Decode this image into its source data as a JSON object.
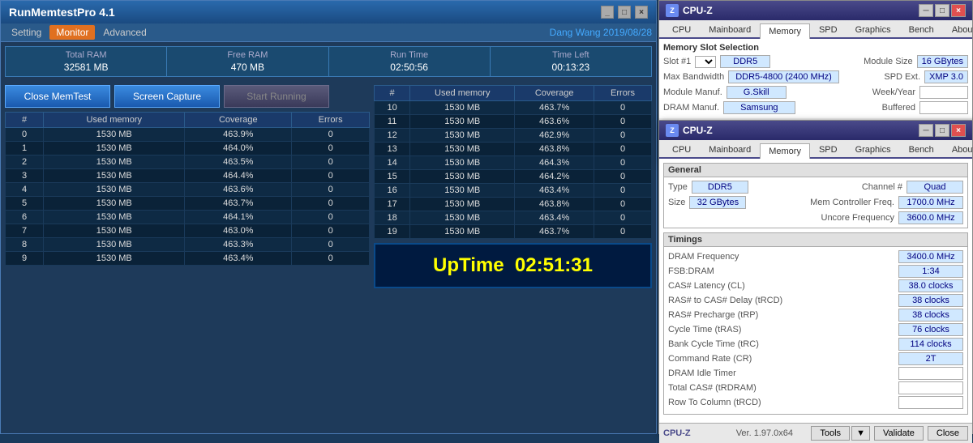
{
  "memtest": {
    "title": "RunMemtestPro 4.1",
    "menu": {
      "items": [
        "Setting",
        "Monitor",
        "Advanced"
      ],
      "active": "Monitor"
    },
    "user_info": "Dang Wang 2019/08/28",
    "stats": {
      "total_ram_label": "Total RAM",
      "free_ram_label": "Free RAM",
      "run_time_label": "Run Time",
      "time_left_label": "Time Left",
      "total_ram": "32581 MB",
      "free_ram": "470 MB",
      "run_time": "02:50:56",
      "time_left": "00:13:23"
    },
    "buttons": {
      "close": "Close MemTest",
      "capture": "Screen Capture",
      "start": "Start Running"
    },
    "left_table": {
      "headers": [
        "#",
        "Used memory",
        "Coverage",
        "Errors"
      ],
      "rows": [
        [
          "0",
          "1530 MB",
          "463.9%",
          "0"
        ],
        [
          "1",
          "1530 MB",
          "464.0%",
          "0"
        ],
        [
          "2",
          "1530 MB",
          "463.5%",
          "0"
        ],
        [
          "3",
          "1530 MB",
          "464.4%",
          "0"
        ],
        [
          "4",
          "1530 MB",
          "463.6%",
          "0"
        ],
        [
          "5",
          "1530 MB",
          "463.7%",
          "0"
        ],
        [
          "6",
          "1530 MB",
          "464.1%",
          "0"
        ],
        [
          "7",
          "1530 MB",
          "463.0%",
          "0"
        ],
        [
          "8",
          "1530 MB",
          "463.3%",
          "0"
        ],
        [
          "9",
          "1530 MB",
          "463.4%",
          "0"
        ]
      ]
    },
    "right_table": {
      "headers": [
        "#",
        "Used memory",
        "Coverage",
        "Errors"
      ],
      "rows": [
        [
          "10",
          "1530 MB",
          "463.7%",
          "0"
        ],
        [
          "11",
          "1530 MB",
          "463.6%",
          "0"
        ],
        [
          "12",
          "1530 MB",
          "462.9%",
          "0"
        ],
        [
          "13",
          "1530 MB",
          "463.8%",
          "0"
        ],
        [
          "14",
          "1530 MB",
          "464.3%",
          "0"
        ],
        [
          "15",
          "1530 MB",
          "464.2%",
          "0"
        ],
        [
          "16",
          "1530 MB",
          "463.4%",
          "0"
        ],
        [
          "17",
          "1530 MB",
          "463.8%",
          "0"
        ],
        [
          "18",
          "1530 MB",
          "463.4%",
          "0"
        ],
        [
          "19",
          "1530 MB",
          "463.7%",
          "0"
        ]
      ]
    },
    "uptime_label": "UpTime",
    "uptime_value": "02:51:31"
  },
  "cpuz_window1": {
    "title": "CPU-Z",
    "tabs": [
      "CPU",
      "Mainboard",
      "Memory",
      "SPD",
      "Graphics",
      "Bench",
      "About"
    ],
    "active_tab": "Memory",
    "slot_section": {
      "title": "Memory Slot Selection",
      "slot_label": "Slot #1",
      "ddr_type": "DDR5",
      "module_size_label": "Module Size",
      "module_size": "16 GBytes",
      "max_bw_label": "Max Bandwidth",
      "max_bw": "DDR5-4800 (2400 MHz)",
      "spd_ext_label": "SPD Ext.",
      "spd_ext": "XMP 3.0",
      "module_manuf_label": "Module Manuf.",
      "module_manuf": "G.Skill",
      "week_year_label": "Week/Year",
      "week_year": "",
      "dram_manuf_label": "DRAM Manuf.",
      "dram_manuf": "Samsung",
      "buffered_label": "Buffered",
      "buffered": ""
    }
  },
  "cpuz_window2": {
    "title": "CPU-Z",
    "tabs": [
      "CPU",
      "Mainboard",
      "Memory",
      "SPD",
      "Graphics",
      "Bench",
      "About"
    ],
    "active_tab": "Memory",
    "general": {
      "title": "General",
      "type_label": "Type",
      "type": "DDR5",
      "channel_label": "Channel #",
      "channel": "Quad",
      "size_label": "Size",
      "size": "32 GBytes",
      "mem_ctrl_freq_label": "Mem Controller Freq.",
      "mem_ctrl_freq": "1700.0 MHz",
      "uncore_freq_label": "Uncore Frequency",
      "uncore_freq": "3600.0 MHz"
    },
    "timings": {
      "title": "Timings",
      "rows": [
        {
          "label": "DRAM Frequency",
          "value": "3400.0 MHz"
        },
        {
          "label": "FSB:DRAM",
          "value": "1:34"
        },
        {
          "label": "CAS# Latency (CL)",
          "value": "38.0 clocks"
        },
        {
          "label": "RAS# to CAS# Delay (tRCD)",
          "value": "38 clocks"
        },
        {
          "label": "RAS# Precharge (tRP)",
          "value": "38 clocks"
        },
        {
          "label": "Cycle Time (tRAS)",
          "value": "76 clocks"
        },
        {
          "label": "Bank Cycle Time (tRC)",
          "value": "114 clocks"
        },
        {
          "label": "Command Rate (CR)",
          "value": "2T"
        },
        {
          "label": "DRAM Idle Timer",
          "value": ""
        },
        {
          "label": "Total CAS# (tRDRAM)",
          "value": ""
        },
        {
          "label": "Row To Column (tRCD)",
          "value": ""
        }
      ]
    },
    "footer": {
      "brand": "CPU-Z",
      "version": "Ver. 1.97.0x64",
      "tools_label": "Tools",
      "validate_label": "Validate",
      "close_label": "Close"
    }
  }
}
